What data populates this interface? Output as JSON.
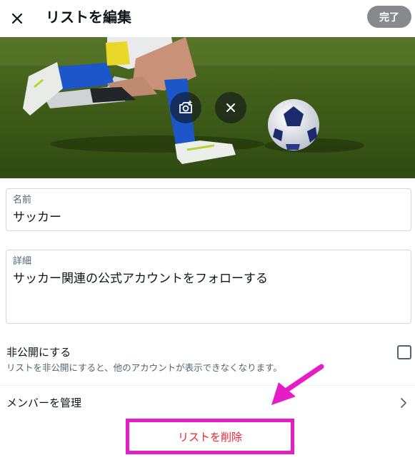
{
  "header": {
    "title": "リストを編集",
    "done_label": "完了"
  },
  "form": {
    "name": {
      "label": "名前",
      "value": "サッカー"
    },
    "description": {
      "label": "詳細",
      "value": "サッカー関連の公式アカウントをフォローする"
    }
  },
  "privacy": {
    "title": "非公開にする",
    "subtitle": "リストを非公開にすると、他のアカウントが表示できなくなります。",
    "checked": false
  },
  "members_label": "メンバーを管理",
  "delete_label": "リストを削除",
  "colors": {
    "done_button": "#87898c",
    "delete_text": "#f4212e",
    "highlight_annotation": "#e61cc4"
  },
  "icons": {
    "close": "close-icon",
    "camera": "add-photo-icon",
    "remove_photo": "close-icon",
    "chevron": "chevron-right-icon",
    "annotation": "pointer-arrow-icon"
  }
}
